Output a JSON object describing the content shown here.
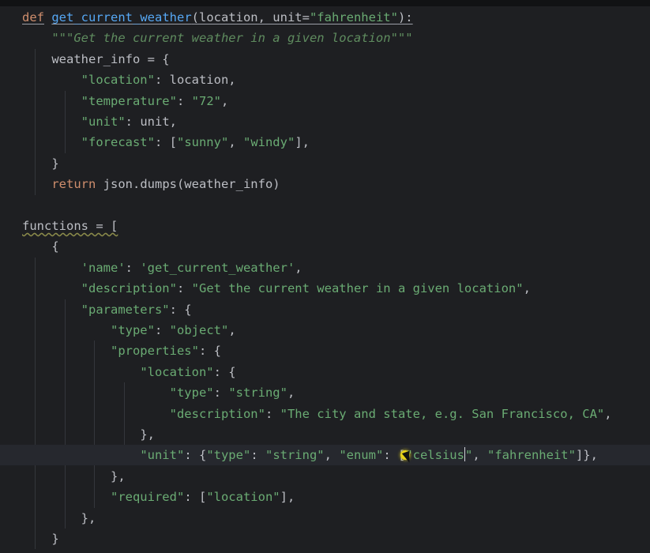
{
  "editor": {
    "lines": [
      {
        "tokens": [
          {
            "t": "def",
            "c": "tok-kw tok-under"
          },
          {
            "t": " "
          },
          {
            "t": "get_current_weather",
            "c": "tok-fn tok-under"
          },
          {
            "t": "(location, unit=",
            "c": "tok-id tok-under"
          },
          {
            "t": "\"fahrenheit\"",
            "c": "tok-str tok-under"
          },
          {
            "t": "):",
            "c": "tok-punct tok-under"
          }
        ]
      },
      {
        "tokens": [
          {
            "t": "    "
          },
          {
            "t": "\"\"\"Get the current weather in a given location\"\"\"",
            "c": "tok-doc"
          }
        ]
      },
      {
        "tokens": [
          {
            "t": "    "
          },
          {
            "t": "weather_info = {",
            "c": "tok-id"
          }
        ]
      },
      {
        "tokens": [
          {
            "t": "        "
          },
          {
            "t": "\"location\"",
            "c": "tok-str"
          },
          {
            "t": ": location,",
            "c": "tok-id"
          }
        ]
      },
      {
        "tokens": [
          {
            "t": "        "
          },
          {
            "t": "\"temperature\"",
            "c": "tok-str"
          },
          {
            "t": ": ",
            "c": "tok-id"
          },
          {
            "t": "\"72\"",
            "c": "tok-str"
          },
          {
            "t": ",",
            "c": "tok-id"
          }
        ]
      },
      {
        "tokens": [
          {
            "t": "        "
          },
          {
            "t": "\"unit\"",
            "c": "tok-str"
          },
          {
            "t": ": unit,",
            "c": "tok-id"
          }
        ]
      },
      {
        "tokens": [
          {
            "t": "        "
          },
          {
            "t": "\"forecast\"",
            "c": "tok-str"
          },
          {
            "t": ": [",
            "c": "tok-id"
          },
          {
            "t": "\"sunny\"",
            "c": "tok-str"
          },
          {
            "t": ", ",
            "c": "tok-id"
          },
          {
            "t": "\"windy\"",
            "c": "tok-str"
          },
          {
            "t": "],",
            "c": "tok-id"
          }
        ]
      },
      {
        "tokens": [
          {
            "t": "    "
          },
          {
            "t": "}",
            "c": "tok-id"
          }
        ]
      },
      {
        "tokens": [
          {
            "t": "    "
          },
          {
            "t": "return",
            "c": "tok-kw"
          },
          {
            "t": " json.dumps(weather_info)",
            "c": "tok-id"
          }
        ]
      },
      {
        "tokens": []
      },
      {
        "tokens": [
          {
            "t": "functions = [",
            "c": "tok-id tok-squiggle"
          }
        ]
      },
      {
        "tokens": [
          {
            "t": "    "
          },
          {
            "t": "{",
            "c": "tok-id"
          }
        ]
      },
      {
        "tokens": [
          {
            "t": "        "
          },
          {
            "t": "'name'",
            "c": "tok-str"
          },
          {
            "t": ": ",
            "c": "tok-id"
          },
          {
            "t": "'get_current_weather'",
            "c": "tok-str"
          },
          {
            "t": ",",
            "c": "tok-id"
          }
        ]
      },
      {
        "tokens": [
          {
            "t": "        "
          },
          {
            "t": "\"description\"",
            "c": "tok-str"
          },
          {
            "t": ": ",
            "c": "tok-id"
          },
          {
            "t": "\"Get the current weather in a given location\"",
            "c": "tok-str"
          },
          {
            "t": ",",
            "c": "tok-id"
          }
        ]
      },
      {
        "tokens": [
          {
            "t": "        "
          },
          {
            "t": "\"parameters\"",
            "c": "tok-str"
          },
          {
            "t": ": {",
            "c": "tok-id"
          }
        ]
      },
      {
        "tokens": [
          {
            "t": "            "
          },
          {
            "t": "\"type\"",
            "c": "tok-str"
          },
          {
            "t": ": ",
            "c": "tok-id"
          },
          {
            "t": "\"object\"",
            "c": "tok-str"
          },
          {
            "t": ",",
            "c": "tok-id"
          }
        ]
      },
      {
        "tokens": [
          {
            "t": "            "
          },
          {
            "t": "\"properties\"",
            "c": "tok-str"
          },
          {
            "t": ": {",
            "c": "tok-id"
          }
        ]
      },
      {
        "tokens": [
          {
            "t": "                "
          },
          {
            "t": "\"location\"",
            "c": "tok-str"
          },
          {
            "t": ": {",
            "c": "tok-id"
          }
        ]
      },
      {
        "tokens": [
          {
            "t": "                    "
          },
          {
            "t": "\"type\"",
            "c": "tok-str"
          },
          {
            "t": ": ",
            "c": "tok-id"
          },
          {
            "t": "\"string\"",
            "c": "tok-str"
          },
          {
            "t": ",",
            "c": "tok-id"
          }
        ]
      },
      {
        "tokens": [
          {
            "t": "                    "
          },
          {
            "t": "\"description\"",
            "c": "tok-str"
          },
          {
            "t": ": ",
            "c": "tok-id"
          },
          {
            "t": "\"The city and state, e.g. San Francisco, CA\"",
            "c": "tok-str"
          },
          {
            "t": ",",
            "c": "tok-id"
          }
        ]
      },
      {
        "tokens": [
          {
            "t": "                "
          },
          {
            "t": "},",
            "c": "tok-id"
          }
        ]
      },
      {
        "current": true,
        "tokens": [
          {
            "t": "                "
          },
          {
            "t": "\"unit\"",
            "c": "tok-str"
          },
          {
            "t": ": {",
            "c": "tok-id"
          },
          {
            "t": "\"type\"",
            "c": "tok-str"
          },
          {
            "t": ": ",
            "c": "tok-id"
          },
          {
            "t": "\"string\"",
            "c": "tok-str"
          },
          {
            "t": ", ",
            "c": "tok-id"
          },
          {
            "t": "\"enum\"",
            "c": "tok-str"
          },
          {
            "t": ": [",
            "c": "tok-id"
          },
          {
            "t": "\"celsius",
            "c": "tok-str"
          },
          {
            "caret": true
          },
          {
            "t": "\"",
            "c": "tok-str"
          },
          {
            "t": ", ",
            "c": "tok-id"
          },
          {
            "t": "\"fahrenheit\"",
            "c": "tok-str"
          },
          {
            "t": "]},",
            "c": "tok-id"
          }
        ]
      },
      {
        "tokens": [
          {
            "t": "            "
          },
          {
            "t": "},",
            "c": "tok-id"
          }
        ]
      },
      {
        "tokens": [
          {
            "t": "            "
          },
          {
            "t": "\"required\"",
            "c": "tok-str"
          },
          {
            "t": ": [",
            "c": "tok-id"
          },
          {
            "t": "\"location\"",
            "c": "tok-str"
          },
          {
            "t": "],",
            "c": "tok-id"
          }
        ]
      },
      {
        "tokens": [
          {
            "t": "        "
          },
          {
            "t": "},",
            "c": "tok-id"
          }
        ]
      },
      {
        "tokens": [
          {
            "t": "    "
          },
          {
            "t": "}",
            "c": "tok-id"
          }
        ]
      }
    ]
  },
  "colors": {
    "background": "#1e1f22",
    "keyword": "#cf8e6d",
    "function": "#56a8f5",
    "string": "#6aab73",
    "docstring": "#5f8c5f",
    "identifier": "#bcbec4",
    "mouse_highlight": "#e7d21a"
  },
  "icons": {
    "mouse_cursor": "pointer-cursor-icon",
    "cursor_highlight": "cursor-highlight-dot"
  }
}
